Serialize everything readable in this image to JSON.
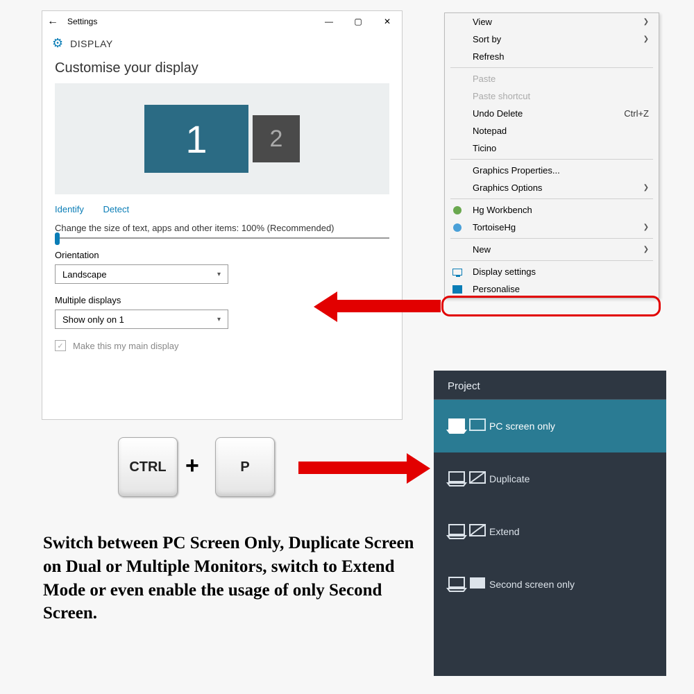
{
  "settings": {
    "title": "Settings",
    "header": "DISPLAY",
    "section": "Customise your display",
    "monitor1": "1",
    "monitor2": "2",
    "identify": "Identify",
    "detect": "Detect",
    "scale_label": "Change the size of text, apps and other items: 100% (Recommended)",
    "orientation_label": "Orientation",
    "orientation_value": "Landscape",
    "multi_label": "Multiple displays",
    "multi_value": "Show only on 1",
    "main_check": "Make this my main display"
  },
  "context": {
    "items": [
      {
        "label": "View",
        "arrow": true
      },
      {
        "label": "Sort by",
        "arrow": true
      },
      {
        "label": "Refresh"
      },
      {
        "sep": true
      },
      {
        "label": "Paste",
        "disabled": true
      },
      {
        "label": "Paste shortcut",
        "disabled": true
      },
      {
        "label": "Undo Delete",
        "shortcut": "Ctrl+Z"
      },
      {
        "label": "Notepad"
      },
      {
        "label": "Ticino"
      },
      {
        "sep": true
      },
      {
        "label": "Graphics Properties..."
      },
      {
        "label": "Graphics Options",
        "arrow": true
      },
      {
        "sep": true
      },
      {
        "label": "Hg Workbench",
        "icon": "hg"
      },
      {
        "label": "TortoiseHg",
        "arrow": true,
        "icon": "thg"
      },
      {
        "sep": true
      },
      {
        "label": "New",
        "arrow": true
      },
      {
        "sep": true
      },
      {
        "label": "Display settings",
        "icon": "display"
      },
      {
        "label": "Personalise",
        "icon": "personalise"
      }
    ]
  },
  "keys": {
    "ctrl": "CTRL",
    "plus": "+",
    "p": "P"
  },
  "caption": "Switch between PC Screen Only, Duplicate Screen on Dual or Multiple Monitors, switch to Extend Mode or even enable the usage of only Second Screen.",
  "project": {
    "title": "Project",
    "items": [
      {
        "label": "PC screen only",
        "active": true
      },
      {
        "label": "Duplicate"
      },
      {
        "label": "Extend"
      },
      {
        "label": "Second screen only"
      }
    ]
  }
}
